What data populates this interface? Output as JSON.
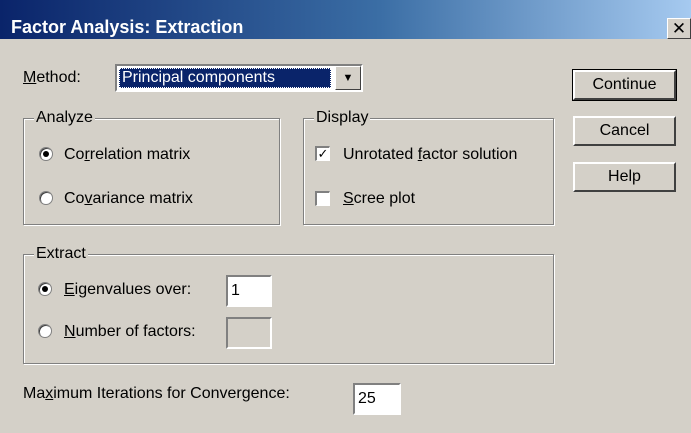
{
  "window": {
    "title": "Factor Analysis: Extraction",
    "close_glyph": "✕"
  },
  "method": {
    "label_pre": "",
    "label_ul": "M",
    "label_post": "ethod:",
    "selected": "Principal components",
    "arrow_icon": "▼"
  },
  "buttons": {
    "continue": "Continue",
    "cancel": "Cancel",
    "help": "Help"
  },
  "analyze": {
    "legend": "Analyze",
    "correlation": {
      "pre": "Co",
      "ul": "r",
      "post": "relation matrix",
      "selected": true
    },
    "covariance": {
      "pre": "Co",
      "ul": "v",
      "post": "ariance matrix",
      "selected": false
    }
  },
  "display": {
    "legend": "Display",
    "unrotated": {
      "pre": "Unrotated ",
      "ul": "f",
      "post": "actor solution",
      "checked": true,
      "mark": "✓"
    },
    "scree": {
      "pre": "",
      "ul": "S",
      "post": "cree plot",
      "checked": false,
      "mark": ""
    }
  },
  "extract": {
    "legend": "Extract",
    "eigen": {
      "pre": "",
      "ul": "E",
      "post": "igenvalues over:",
      "value": "1",
      "selected": true
    },
    "nfactors": {
      "pre": "",
      "ul": "N",
      "post": "umber of factors:",
      "value": "",
      "selected": false
    }
  },
  "iterations": {
    "pre": "Ma",
    "ul": "x",
    "post": "imum Iterations for Convergence:",
    "value": "25"
  }
}
